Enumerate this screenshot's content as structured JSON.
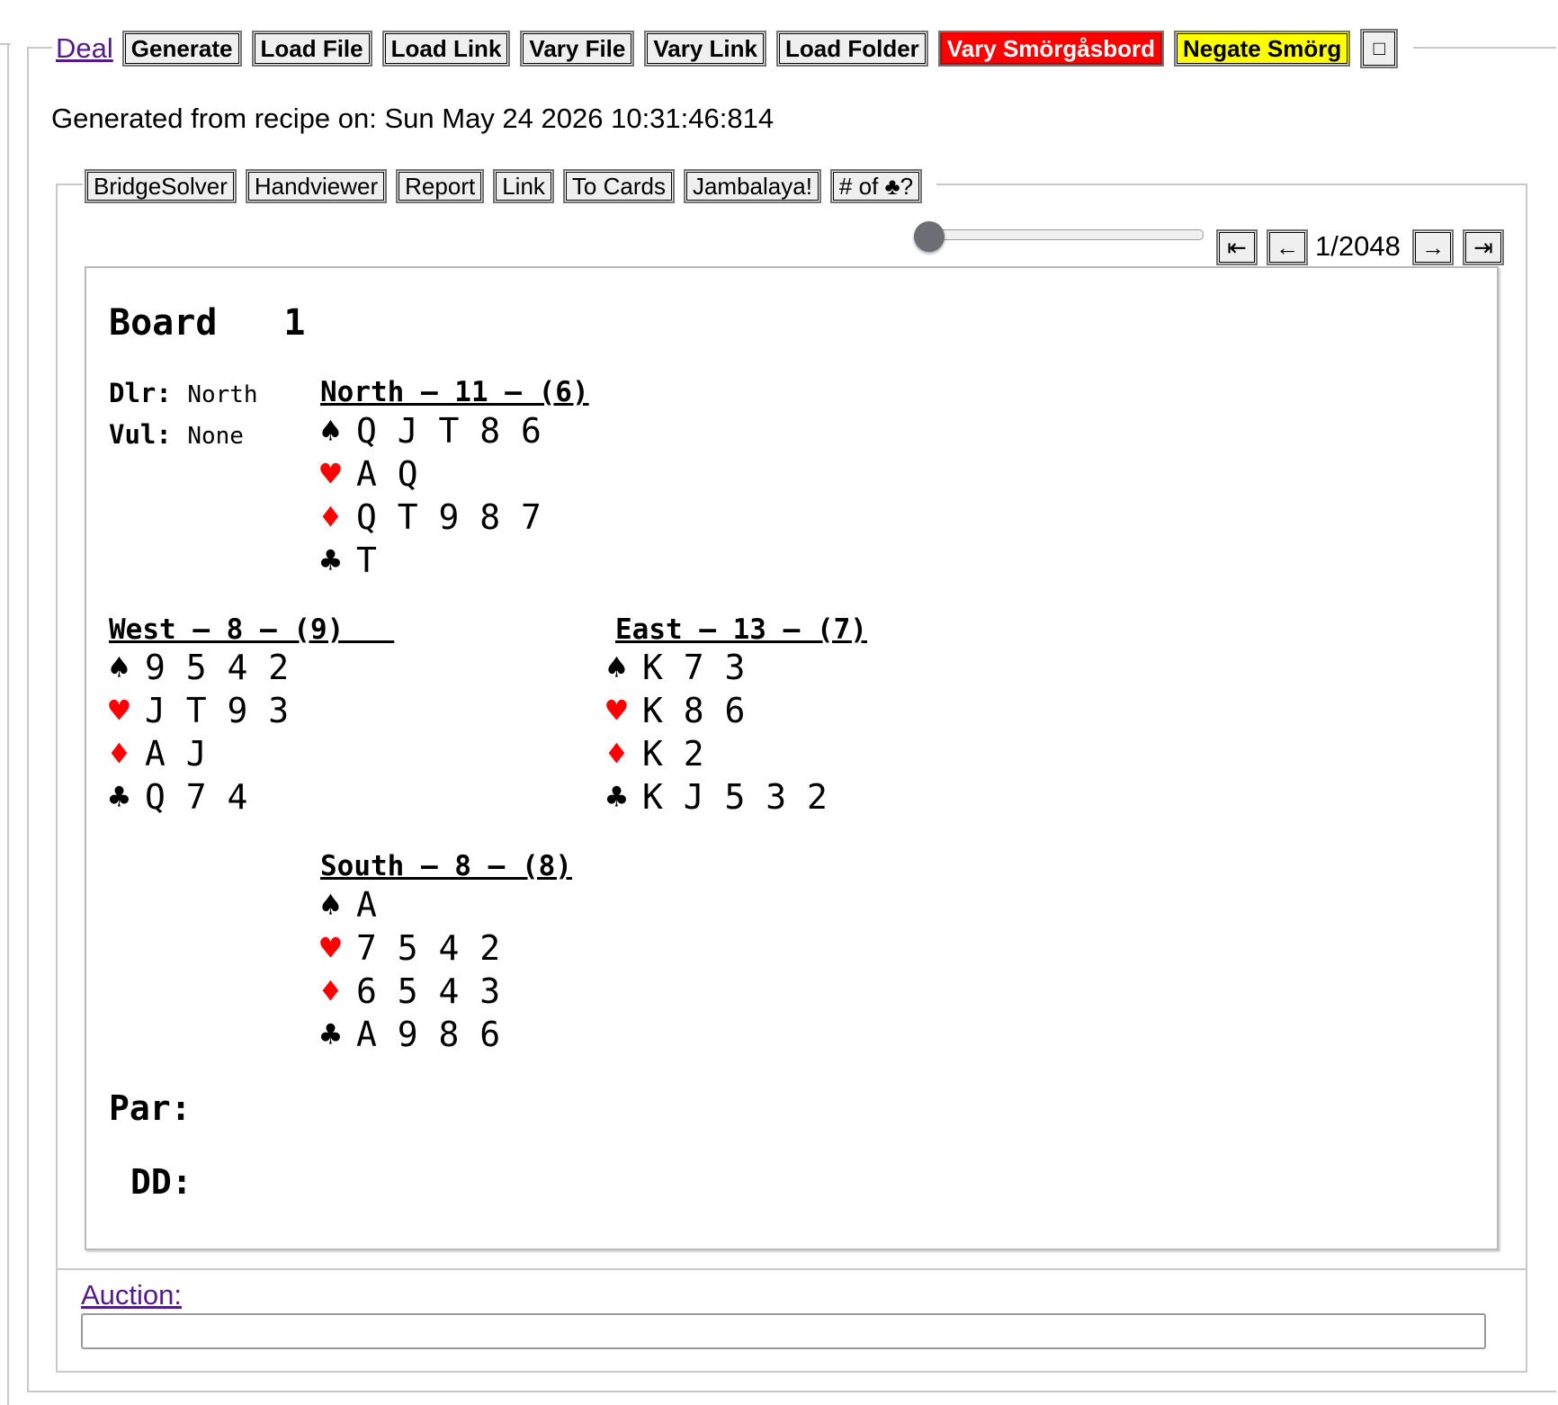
{
  "toolbar": {
    "deal_link": "Deal",
    "generate": "Generate",
    "load_file": "Load File",
    "load_link": "Load Link",
    "vary_file": "Vary File",
    "vary_link": "Vary Link",
    "load_folder": "Load Folder",
    "vary_smorg": "Vary Smörgåsbord",
    "negate_smorg": "Negate Smörg",
    "square": "□"
  },
  "generated_text": "Generated from recipe on: Sun May 24 2026 10:31:46:814",
  "tools": {
    "bridgesolver": "BridgeSolver",
    "handviewer": "Handviewer",
    "report": "Report",
    "link": "Link",
    "to_cards": "To Cards",
    "jambalaya": "Jambalaya!",
    "num_clubs": "# of ♣?"
  },
  "nav": {
    "first": "⇤",
    "prev": "←",
    "page": "1/2048",
    "next": "→",
    "last": "⇥",
    "slider_position": 0
  },
  "board": {
    "title": "Board",
    "number": "1",
    "dealer_label": "Dlr:",
    "dealer": "North",
    "vul_label": "Vul:",
    "vul": "None",
    "suit_symbols": {
      "spades": "♠",
      "hearts": "♥",
      "diamonds": "♦",
      "clubs": "♣"
    },
    "north": {
      "heading": "North – 11 – (6)",
      "spades": "Q J T 8 6",
      "hearts": "A Q",
      "diamonds": "Q T 9 8 7",
      "clubs": "T"
    },
    "west": {
      "heading": "West – 8 – (9)   ",
      "spades": "9 5 4 2",
      "hearts": "J T 9 3",
      "diamonds": "A J",
      "clubs": "Q 7 4"
    },
    "east": {
      "heading": "East – 13 – (7)",
      "spades": "K 7 3",
      "hearts": "K 8 6",
      "diamonds": "K 2",
      "clubs": "K J 5 3 2"
    },
    "south": {
      "heading": "South – 8 – (8)",
      "spades": "A",
      "hearts": "7 5 4 2",
      "diamonds": "6 5 4 3",
      "clubs": "A 9 8 6"
    },
    "par_label": "Par:",
    "dd_label": "DD:"
  },
  "auction": {
    "label": "Auction:",
    "value": ""
  },
  "colors": {
    "red_suit": "#ff0000",
    "vary_button": "#ff0000",
    "negate_button": "#ffff00",
    "link": "#551a8b"
  }
}
